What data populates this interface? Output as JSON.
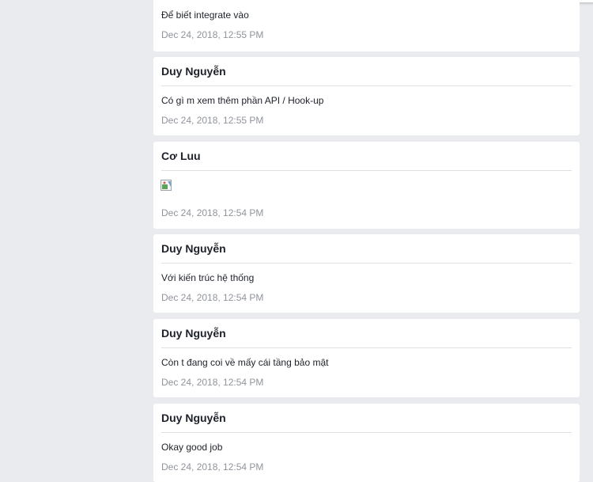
{
  "messages": [
    {
      "text": "Để biết integrate vào",
      "time": "Dec 24, 2018, 12:55 PM"
    },
    {
      "author": "Duy Nguyễn",
      "text": "Có gì m xem thêm phần API / Hook-up",
      "time": "Dec 24, 2018, 12:55 PM"
    },
    {
      "author": "Cơ Luu",
      "image": "broken-image-icon",
      "time": "Dec 24, 2018, 12:54 PM"
    },
    {
      "author": "Duy Nguyễn",
      "text": "Với kiến trúc hệ thống",
      "time": "Dec 24, 2018, 12:54 PM"
    },
    {
      "author": "Duy Nguyễn",
      "text": "Còn t đang coi về mấy cái tầng bảo mật",
      "time": "Dec 24, 2018, 12:54 PM"
    },
    {
      "author": "Duy Nguyễn",
      "text": "Okay good job",
      "time": "Dec 24, 2018, 12:54 PM"
    }
  ]
}
